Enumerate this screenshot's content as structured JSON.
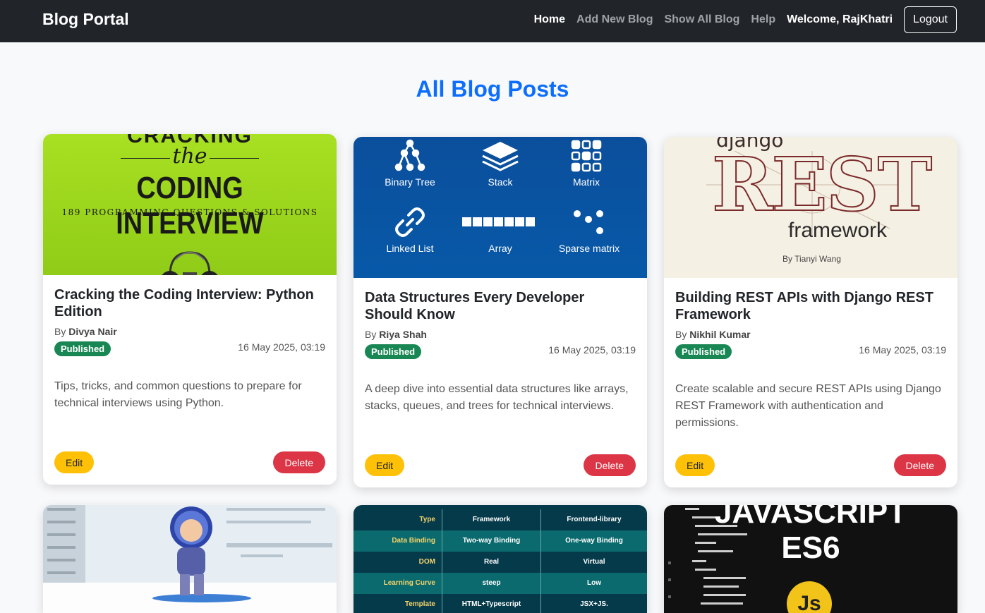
{
  "nav": {
    "brand": "Blog Portal",
    "links": [
      "Home",
      "Add New Blog",
      "Show All Blog",
      "Help"
    ],
    "welcome": "Welcome, RajKhatri",
    "logout": "Logout"
  },
  "page": {
    "title": "All Blog Posts"
  },
  "posts": [
    {
      "title": "Cracking the Coding Interview: Python Edition",
      "by": "By",
      "author": "Divya Nair",
      "status": "Published",
      "date": "16 May 2025, 03:19",
      "description": "Tips, tricks, and common questions to prepare for technical interviews using Python.",
      "edit": "Edit",
      "delete": "Delete",
      "image_text": {
        "top": "CRACKING",
        "the": "the",
        "main": "CODING INTERVIEW",
        "sub": "189 PROGRAMMING QUESTIONS & SOLUTIONS"
      }
    },
    {
      "title": "Data Structures Every Developer Should Know",
      "by": "By",
      "author": "Riya Shah",
      "status": "Published",
      "date": "16 May 2025, 03:19",
      "description": "A deep dive into essential data structures like arrays, stacks, queues, and trees for technical interviews.",
      "edit": "Edit",
      "delete": "Delete",
      "image_text": {
        "labels": [
          "Binary Tree",
          "Stack",
          "Matrix",
          "Linked List",
          "Array",
          "Sparse matrix"
        ]
      }
    },
    {
      "title": "Building REST APIs with Django REST Framework",
      "by": "By",
      "author": "Nikhil Kumar",
      "status": "Published",
      "date": "16 May 2025, 03:19",
      "description": "Create scalable and secure REST APIs using Django REST Framework with authentication and permissions.",
      "edit": "Edit",
      "delete": "Delete",
      "image_text": {
        "top": "django",
        "big": "REST",
        "framework": "framework",
        "author": "By Tianyi Wang"
      }
    }
  ],
  "bottom_images": {
    "table": {
      "rows": [
        [
          "Type",
          "Framework",
          "Frontend-library"
        ],
        [
          "Data Binding",
          "Two-way Binding",
          "One-way Binding"
        ],
        [
          "DOM",
          "Real",
          "Virtual"
        ],
        [
          "Learning Curve",
          "steep",
          "Low"
        ],
        [
          "Template",
          "HTML+Typescript",
          "JSX+JS."
        ]
      ]
    },
    "js": {
      "title_line1": "JAVASCRIPT",
      "title_line2": "ES6",
      "badge": "Js"
    }
  }
}
